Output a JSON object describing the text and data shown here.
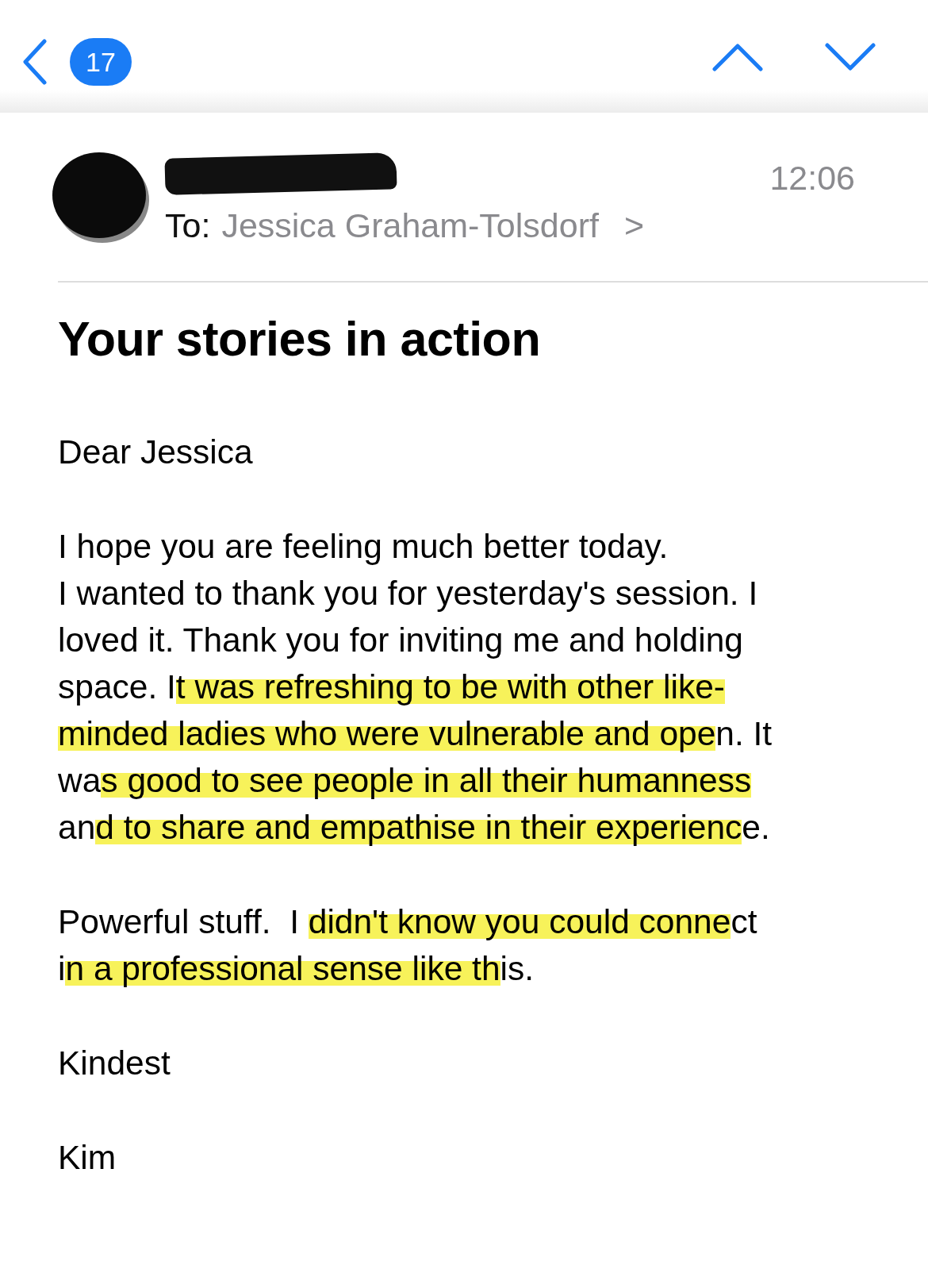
{
  "nav": {
    "unread_count": "17"
  },
  "header": {
    "time": "12:06",
    "to_label": "To:",
    "recipient": "Jessica Graham-Tolsdorf",
    "chevron": ">"
  },
  "subject": "Your stories in action",
  "body": [
    {
      "segments": [
        {
          "text": "Dear Jessica",
          "highlighted": false
        }
      ]
    },
    {
      "segments": [
        {
          "text": "I hope you are feeling much better today.\nI wanted to thank you for yesterday's session. I\nloved it. Thank you for inviting me and holding\nspace. I",
          "highlighted": false
        },
        {
          "text": "t was refreshing to be with other like-\nminded ladies who were vulnerable and ope",
          "highlighted": true
        },
        {
          "text": "n. It\nwa",
          "highlighted": false
        },
        {
          "text": "s good to see people in all their humanness",
          "highlighted": true
        },
        {
          "text": "\nan",
          "highlighted": false
        },
        {
          "text": "d to share and empathise in their experienc",
          "highlighted": true
        },
        {
          "text": "e.",
          "highlighted": false
        }
      ]
    },
    {
      "segments": [
        {
          "text": "Powerful stuff.  I ",
          "highlighted": false
        },
        {
          "text": "didn't know you could conne",
          "highlighted": true
        },
        {
          "text": "ct\ni",
          "highlighted": false
        },
        {
          "text": "n a professional sense like th",
          "highlighted": true
        },
        {
          "text": "is.",
          "highlighted": false
        }
      ]
    },
    {
      "segments": [
        {
          "text": "Kindest",
          "highlighted": false
        }
      ]
    },
    {
      "segments": [
        {
          "text": "Kim",
          "highlighted": false
        }
      ]
    }
  ]
}
